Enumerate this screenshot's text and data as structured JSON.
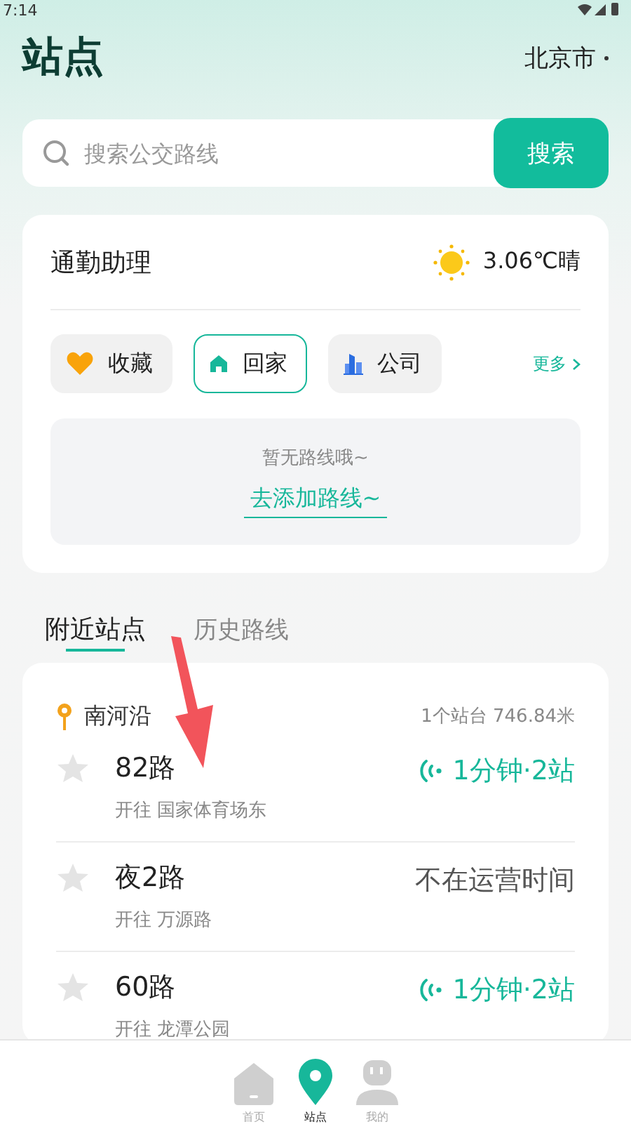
{
  "status_bar": {
    "time": "7:14"
  },
  "header": {
    "title": "站点",
    "city": "北京市"
  },
  "search": {
    "placeholder": "搜索公交路线",
    "button": "搜索"
  },
  "commute": {
    "title": "通勤助理",
    "weather": "3.06℃晴",
    "shortcuts": [
      {
        "label": "收藏",
        "kind": "favorite",
        "selected": false
      },
      {
        "label": "回家",
        "kind": "home",
        "selected": true
      },
      {
        "label": "公司",
        "kind": "company",
        "selected": false
      }
    ],
    "more": "更多",
    "empty_text": "暂无路线哦~",
    "add_link": "去添加路线~"
  },
  "tabs": [
    {
      "label": "附近站点",
      "selected": true
    },
    {
      "label": "历史路线",
      "selected": false
    }
  ],
  "station": {
    "name": "南河沿",
    "info": "1个站台 746.84米",
    "routes": [
      {
        "name": "82路",
        "destination": "开往 国家体育场东",
        "status": "1分钟·2站",
        "kind": "arriving",
        "starred": false
      },
      {
        "name": "夜2路",
        "destination": "开往 万源路",
        "status": "不在运营时间",
        "kind": "not_running",
        "starred": false
      },
      {
        "name": "60路",
        "destination": "开往 龙潭公园",
        "status": "1分钟·2站",
        "kind": "arriving",
        "starred": false
      }
    ]
  },
  "bottom_nav": [
    {
      "label": "首页",
      "kind": "home",
      "selected": false
    },
    {
      "label": "站点",
      "kind": "stations",
      "selected": true
    },
    {
      "label": "我的",
      "kind": "profile",
      "selected": false
    }
  ]
}
